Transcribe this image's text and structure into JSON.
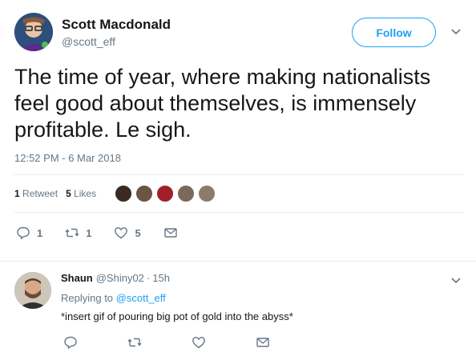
{
  "tweet": {
    "author_name": "Scott Macdonald",
    "author_handle": "@scott_eff",
    "follow_label": "Follow",
    "text": "The time of year, where making nationalists feel good about themselves, is immensely profitable. Le sigh.",
    "timestamp": "12:52 PM - 6 Mar 2018",
    "retweets_count": "1",
    "retweets_label": "Retweet",
    "likes_count": "5",
    "likes_label": "Likes",
    "likers": [
      "#3b2a22",
      "#6b5444",
      "#a0202a",
      "#7a6a5e",
      "#8c7b69"
    ],
    "actions": {
      "reply_count": "1",
      "retweet_count": "1",
      "like_count": "5"
    }
  },
  "reply": {
    "name": "Shaun",
    "handle": "@Shiny02",
    "separator": "·",
    "time": "15h",
    "replying_prefix": "Replying to",
    "replying_to": "@scott_eff",
    "text": "*insert gif of pouring big pot of gold into the abyss*"
  },
  "colors": {
    "accent": "#1da1f2",
    "muted": "#657786",
    "text": "#14171a",
    "border": "#e6ecf0"
  }
}
